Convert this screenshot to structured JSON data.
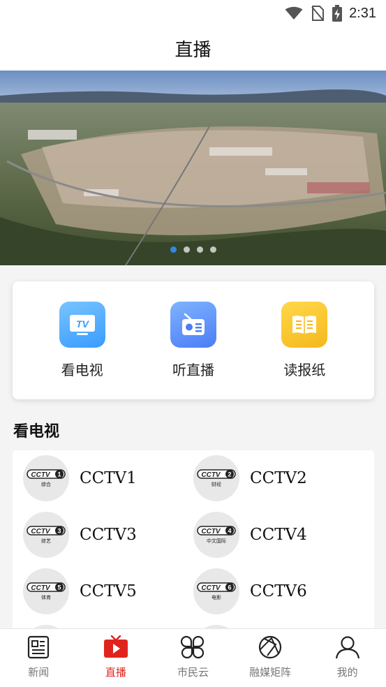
{
  "status_bar": {
    "time": "2:31",
    "icons": [
      "wifi-icon",
      "no-sim-icon",
      "battery-charging-icon"
    ]
  },
  "header": {
    "title": "直播"
  },
  "banner": {
    "slides": 4,
    "active_index": 0
  },
  "quick_actions": [
    {
      "label": "看电视",
      "icon": "tv-icon",
      "icon_text": "TV"
    },
    {
      "label": "听直播",
      "icon": "radio-icon"
    },
    {
      "label": "读报纸",
      "icon": "newspaper-icon"
    }
  ],
  "tv_section": {
    "title": "看电视",
    "channels": [
      {
        "name": "CCTV1",
        "logo_num": "1",
        "logo_sub": "综合"
      },
      {
        "name": "CCTV2",
        "logo_num": "2",
        "logo_sub": "财经"
      },
      {
        "name": "CCTV3",
        "logo_num": "3",
        "logo_sub": "综艺"
      },
      {
        "name": "CCTV4",
        "logo_num": "4",
        "logo_sub": "中文国际"
      },
      {
        "name": "CCTV5",
        "logo_num": "5",
        "logo_sub": "体育"
      },
      {
        "name": "CCTV6",
        "logo_num": "6",
        "logo_sub": "电影"
      }
    ]
  },
  "tab_bar": {
    "active": "直播",
    "tabs": [
      {
        "label": "新闻",
        "icon": "news-icon"
      },
      {
        "label": "直播",
        "icon": "live-tv-icon"
      },
      {
        "label": "市民云",
        "icon": "clover-icon"
      },
      {
        "label": "融媒矩阵",
        "icon": "media-matrix-icon"
      },
      {
        "label": "我的",
        "icon": "user-icon"
      }
    ]
  },
  "colors": {
    "accent": "#e0241d",
    "dot_active": "#2e8ae6",
    "tab_inactive": "#777777"
  }
}
